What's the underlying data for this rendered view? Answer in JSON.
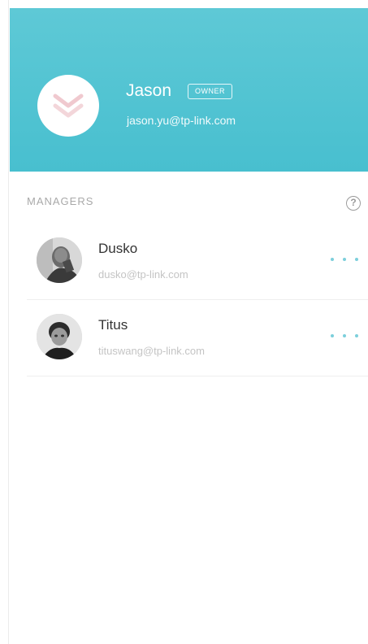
{
  "header": {
    "user_name": "Jason",
    "owner_badge": "OWNER",
    "user_email": "jason.yu@tp-link.com",
    "bg_color": "#4dc1d0",
    "avatar_icon": "user-placeholder-icon"
  },
  "managers_section": {
    "title": "MANAGERS",
    "help_icon": "help-circle-icon",
    "help_glyph": "?"
  },
  "managers": [
    {
      "name": "Dusko",
      "email": "dusko@tp-link.com",
      "avatar": "photo-avatar",
      "more_icon": "more-horizontal-icon"
    },
    {
      "name": "Titus",
      "email": "tituswang@tp-link.com",
      "avatar": "photo-avatar",
      "more_icon": "more-horizontal-icon"
    }
  ],
  "colors": {
    "accent": "#4dc1d0",
    "dots": "#7ccfdb"
  }
}
